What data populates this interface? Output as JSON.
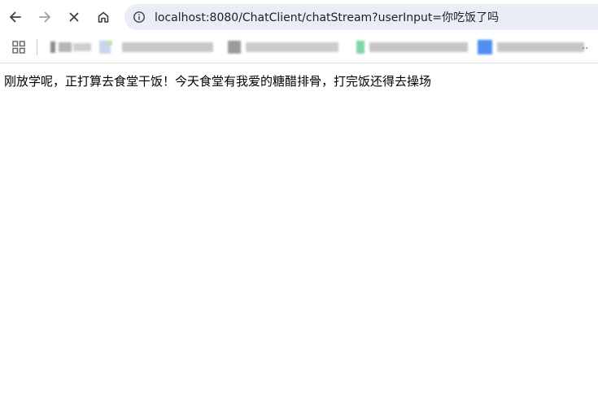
{
  "browser": {
    "address_bar": {
      "url": "localhost:8080/ChatClient/chatStream?userInput=你吃饭了吗"
    },
    "icons": [
      "back-icon",
      "forward-icon",
      "stop-loading-icon",
      "home-icon",
      "site-info-icon",
      "apps-grid-icon"
    ]
  },
  "bookmarks_bar": {
    "overflow_label": ".."
  },
  "page": {
    "body_text": "刚放学呢，正打算去食堂干饭！今天食堂有我爱的糖醋排骨，打完饭还得去操场"
  }
}
